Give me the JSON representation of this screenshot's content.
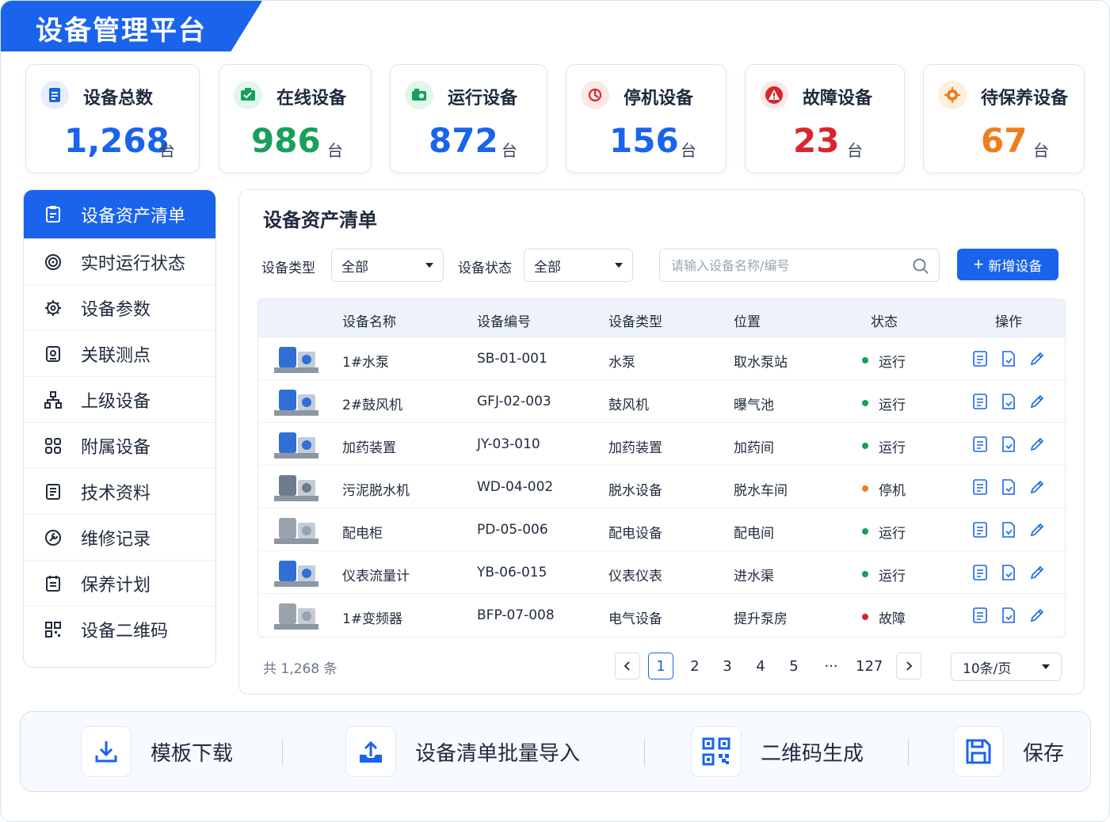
{
  "app": {
    "title": "设备管理平台"
  },
  "colors": {
    "primary": "#1a63ec",
    "online": "#17a05a",
    "warning": "#f07c1c",
    "danger": "#d8262b"
  },
  "stats": [
    {
      "label": "设备总数",
      "value": "1,268",
      "unit": "台",
      "icon": "document-icon",
      "color": "#1a63ec"
    },
    {
      "label": "在线设备",
      "value": "986",
      "unit": "台",
      "icon": "online-equipment-icon",
      "color": "#17a05a"
    },
    {
      "label": "运行设备",
      "value": "872",
      "unit": "台",
      "icon": "running-equipment-icon",
      "color": "#1a63ec"
    },
    {
      "label": "停机设备",
      "value": "156",
      "unit": "台",
      "icon": "power-off-icon",
      "color": "#1a63ec"
    },
    {
      "label": "故障设备",
      "value": "23",
      "unit": "台",
      "icon": "warning-icon",
      "color": "#d8262b"
    },
    {
      "label": "待保养设备",
      "value": "67",
      "unit": "台",
      "icon": "maintenance-gear-icon",
      "color": "#f07c1c"
    }
  ],
  "sidebar": {
    "items": [
      {
        "label": "设备资产清单",
        "icon": "asset-list-icon",
        "active": true
      },
      {
        "label": "实时运行状态",
        "icon": "realtime-status-icon"
      },
      {
        "label": "设备参数",
        "icon": "settings-gear-icon"
      },
      {
        "label": "关联测点",
        "icon": "measure-point-icon"
      },
      {
        "label": "上级设备",
        "icon": "hierarchy-icon"
      },
      {
        "label": "附属设备",
        "icon": "grid-icon"
      },
      {
        "label": "技术资料",
        "icon": "tech-doc-icon"
      },
      {
        "label": "维修记录",
        "icon": "repair-icon"
      },
      {
        "label": "保养计划",
        "icon": "calendar-icon"
      },
      {
        "label": "设备二维码",
        "icon": "qrcode-icon"
      }
    ]
  },
  "main": {
    "title": "设备资产清单",
    "filters": {
      "type_label": "设备类型",
      "type_value": "全部",
      "status_label": "设备状态",
      "status_value": "全部"
    },
    "search": {
      "placeholder": "请输入设备名称/编号",
      "value": ""
    },
    "add_button": "新增设备",
    "columns": [
      "设备名称",
      "设备编号",
      "设备类型",
      "位置",
      "状态",
      "操作"
    ],
    "rows": [
      {
        "name": "1#水泵",
        "code": "SB-01-001",
        "type": "水泵",
        "location": "取水泵站",
        "status": "运行",
        "status_color": "#17a05a"
      },
      {
        "name": "2#鼓风机",
        "code": "GFJ-02-003",
        "type": "鼓风机",
        "location": "曝气池",
        "status": "运行",
        "status_color": "#17a05a"
      },
      {
        "name": "加药装置",
        "code": "JY-03-010",
        "type": "加药装置",
        "location": "加药间",
        "status": "运行",
        "status_color": "#17a05a"
      },
      {
        "name": "污泥脱水机",
        "code": "WD-04-002",
        "type": "脱水设备",
        "location": "脱水车间",
        "status": "停机",
        "status_color": "#f07c1c"
      },
      {
        "name": "配电柜",
        "code": "PD-05-006",
        "type": "配电设备",
        "location": "配电间",
        "status": "运行",
        "status_color": "#17a05a"
      },
      {
        "name": "仪表流量计",
        "code": "YB-06-015",
        "type": "仪表仪表",
        "location": "进水渠",
        "status": "运行",
        "status_color": "#17a05a"
      },
      {
        "name": "1#变频器",
        "code": "BFP-07-008",
        "type": "电气设备",
        "location": "提升泵房",
        "status": "故障",
        "status_color": "#d8262b"
      }
    ],
    "pagination": {
      "total": "共 1,268 条",
      "pages": [
        "1",
        "2",
        "3",
        "4",
        "5",
        "···",
        "127"
      ],
      "current": "1",
      "page_size": "10条/页"
    }
  },
  "actions": [
    {
      "label": "模板下载",
      "icon": "download-icon"
    },
    {
      "label": "设备清单批量导入",
      "icon": "upload-icon"
    },
    {
      "label": "二维码生成",
      "icon": "qrcode-icon"
    },
    {
      "label": "保存",
      "icon": "save-icon"
    }
  ]
}
